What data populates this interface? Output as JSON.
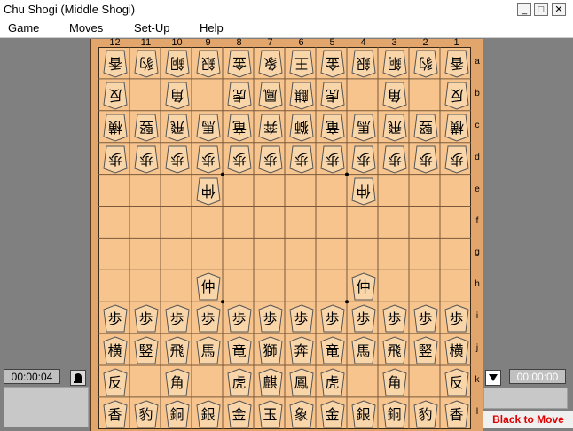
{
  "window": {
    "title": "Chu Shogi (Middle Shogi)"
  },
  "menu": [
    {
      "name": "menu-game",
      "label": "Game"
    },
    {
      "name": "menu-moves",
      "label": "Moves"
    },
    {
      "name": "menu-setup",
      "label": "Set-Up"
    },
    {
      "name": "menu-help",
      "label": "Help"
    }
  ],
  "window_buttons": {
    "minimize": "_",
    "maximize": "□",
    "close": "✕"
  },
  "board": {
    "files": [
      "12",
      "11",
      "10",
      "9",
      "8",
      "7",
      "6",
      "5",
      "4",
      "3",
      "2",
      "1"
    ],
    "ranks": [
      "a",
      "b",
      "c",
      "d",
      "e",
      "f",
      "g",
      "h",
      "i",
      "j",
      "k",
      "l"
    ],
    "colors": {
      "frame": "#e2a56b",
      "square": "#f7c48e",
      "line": "#7a5a3a",
      "piece": "#f8d6aa"
    },
    "gote_rows": [
      [
        "香",
        "豹",
        "銅",
        "銀",
        "金",
        "象",
        "王",
        "金",
        "銀",
        "銅",
        "豹",
        "香"
      ],
      [
        "反",
        "",
        "角",
        "",
        "虎",
        "鳳",
        "麒",
        "虎",
        "",
        "角",
        "",
        "反"
      ],
      [
        "横",
        "竪",
        "飛",
        "馬",
        "竜",
        "奔",
        "獅",
        "竜",
        "馬",
        "飛",
        "竪",
        "横"
      ],
      [
        "歩",
        "歩",
        "歩",
        "歩",
        "歩",
        "歩",
        "歩",
        "歩",
        "歩",
        "歩",
        "歩",
        "歩"
      ]
    ],
    "gote_extra": [
      {
        "row": 4,
        "col": 3,
        "k": "仲"
      },
      {
        "row": 4,
        "col": 8,
        "k": "仲"
      }
    ],
    "sente_rows": [
      [
        "歩",
        "歩",
        "歩",
        "歩",
        "歩",
        "歩",
        "歩",
        "歩",
        "歩",
        "歩",
        "歩",
        "歩"
      ],
      [
        "横",
        "竪",
        "飛",
        "馬",
        "竜",
        "獅",
        "奔",
        "竜",
        "馬",
        "飛",
        "竪",
        "横"
      ],
      [
        "反",
        "",
        "角",
        "",
        "虎",
        "麒",
        "鳳",
        "虎",
        "",
        "角",
        "",
        "反"
      ],
      [
        "香",
        "豹",
        "銅",
        "銀",
        "金",
        "玉",
        "象",
        "金",
        "銀",
        "銅",
        "豹",
        "香"
      ]
    ],
    "sente_extra": [
      {
        "row": 7,
        "col": 3,
        "k": "仲"
      },
      {
        "row": 7,
        "col": 8,
        "k": "仲"
      }
    ]
  },
  "white_clock": "00:00:04",
  "black_clock": "00:00:00",
  "status_text": "Black to Move",
  "icons": {
    "bell": "bell-icon",
    "down": "triangle-down-icon"
  }
}
